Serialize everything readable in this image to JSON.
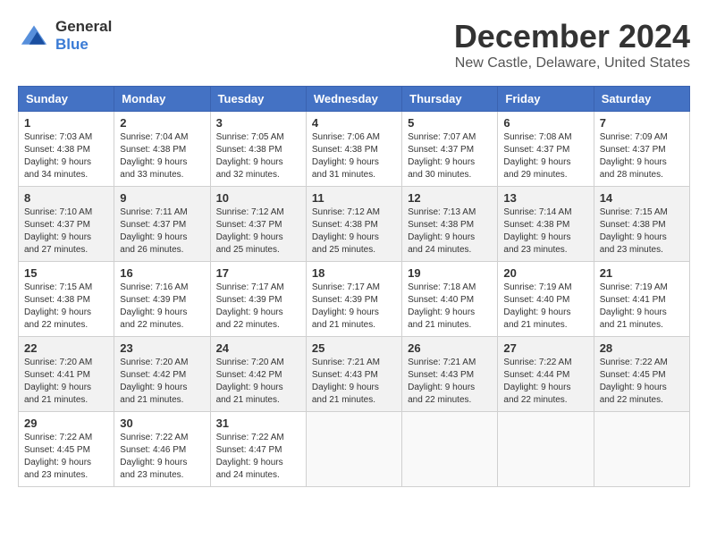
{
  "header": {
    "logo_general": "General",
    "logo_blue": "Blue",
    "title": "December 2024",
    "subtitle": "New Castle, Delaware, United States"
  },
  "columns": [
    "Sunday",
    "Monday",
    "Tuesday",
    "Wednesday",
    "Thursday",
    "Friday",
    "Saturday"
  ],
  "weeks": [
    [
      {
        "day": "1",
        "sunrise": "Sunrise: 7:03 AM",
        "sunset": "Sunset: 4:38 PM",
        "daylight": "Daylight: 9 hours and 34 minutes."
      },
      {
        "day": "2",
        "sunrise": "Sunrise: 7:04 AM",
        "sunset": "Sunset: 4:38 PM",
        "daylight": "Daylight: 9 hours and 33 minutes."
      },
      {
        "day": "3",
        "sunrise": "Sunrise: 7:05 AM",
        "sunset": "Sunset: 4:38 PM",
        "daylight": "Daylight: 9 hours and 32 minutes."
      },
      {
        "day": "4",
        "sunrise": "Sunrise: 7:06 AM",
        "sunset": "Sunset: 4:38 PM",
        "daylight": "Daylight: 9 hours and 31 minutes."
      },
      {
        "day": "5",
        "sunrise": "Sunrise: 7:07 AM",
        "sunset": "Sunset: 4:37 PM",
        "daylight": "Daylight: 9 hours and 30 minutes."
      },
      {
        "day": "6",
        "sunrise": "Sunrise: 7:08 AM",
        "sunset": "Sunset: 4:37 PM",
        "daylight": "Daylight: 9 hours and 29 minutes."
      },
      {
        "day": "7",
        "sunrise": "Sunrise: 7:09 AM",
        "sunset": "Sunset: 4:37 PM",
        "daylight": "Daylight: 9 hours and 28 minutes."
      }
    ],
    [
      {
        "day": "8",
        "sunrise": "Sunrise: 7:10 AM",
        "sunset": "Sunset: 4:37 PM",
        "daylight": "Daylight: 9 hours and 27 minutes."
      },
      {
        "day": "9",
        "sunrise": "Sunrise: 7:11 AM",
        "sunset": "Sunset: 4:37 PM",
        "daylight": "Daylight: 9 hours and 26 minutes."
      },
      {
        "day": "10",
        "sunrise": "Sunrise: 7:12 AM",
        "sunset": "Sunset: 4:37 PM",
        "daylight": "Daylight: 9 hours and 25 minutes."
      },
      {
        "day": "11",
        "sunrise": "Sunrise: 7:12 AM",
        "sunset": "Sunset: 4:38 PM",
        "daylight": "Daylight: 9 hours and 25 minutes."
      },
      {
        "day": "12",
        "sunrise": "Sunrise: 7:13 AM",
        "sunset": "Sunset: 4:38 PM",
        "daylight": "Daylight: 9 hours and 24 minutes."
      },
      {
        "day": "13",
        "sunrise": "Sunrise: 7:14 AM",
        "sunset": "Sunset: 4:38 PM",
        "daylight": "Daylight: 9 hours and 23 minutes."
      },
      {
        "day": "14",
        "sunrise": "Sunrise: 7:15 AM",
        "sunset": "Sunset: 4:38 PM",
        "daylight": "Daylight: 9 hours and 23 minutes."
      }
    ],
    [
      {
        "day": "15",
        "sunrise": "Sunrise: 7:15 AM",
        "sunset": "Sunset: 4:38 PM",
        "daylight": "Daylight: 9 hours and 22 minutes."
      },
      {
        "day": "16",
        "sunrise": "Sunrise: 7:16 AM",
        "sunset": "Sunset: 4:39 PM",
        "daylight": "Daylight: 9 hours and 22 minutes."
      },
      {
        "day": "17",
        "sunrise": "Sunrise: 7:17 AM",
        "sunset": "Sunset: 4:39 PM",
        "daylight": "Daylight: 9 hours and 22 minutes."
      },
      {
        "day": "18",
        "sunrise": "Sunrise: 7:17 AM",
        "sunset": "Sunset: 4:39 PM",
        "daylight": "Daylight: 9 hours and 21 minutes."
      },
      {
        "day": "19",
        "sunrise": "Sunrise: 7:18 AM",
        "sunset": "Sunset: 4:40 PM",
        "daylight": "Daylight: 9 hours and 21 minutes."
      },
      {
        "day": "20",
        "sunrise": "Sunrise: 7:19 AM",
        "sunset": "Sunset: 4:40 PM",
        "daylight": "Daylight: 9 hours and 21 minutes."
      },
      {
        "day": "21",
        "sunrise": "Sunrise: 7:19 AM",
        "sunset": "Sunset: 4:41 PM",
        "daylight": "Daylight: 9 hours and 21 minutes."
      }
    ],
    [
      {
        "day": "22",
        "sunrise": "Sunrise: 7:20 AM",
        "sunset": "Sunset: 4:41 PM",
        "daylight": "Daylight: 9 hours and 21 minutes."
      },
      {
        "day": "23",
        "sunrise": "Sunrise: 7:20 AM",
        "sunset": "Sunset: 4:42 PM",
        "daylight": "Daylight: 9 hours and 21 minutes."
      },
      {
        "day": "24",
        "sunrise": "Sunrise: 7:20 AM",
        "sunset": "Sunset: 4:42 PM",
        "daylight": "Daylight: 9 hours and 21 minutes."
      },
      {
        "day": "25",
        "sunrise": "Sunrise: 7:21 AM",
        "sunset": "Sunset: 4:43 PM",
        "daylight": "Daylight: 9 hours and 21 minutes."
      },
      {
        "day": "26",
        "sunrise": "Sunrise: 7:21 AM",
        "sunset": "Sunset: 4:43 PM",
        "daylight": "Daylight: 9 hours and 22 minutes."
      },
      {
        "day": "27",
        "sunrise": "Sunrise: 7:22 AM",
        "sunset": "Sunset: 4:44 PM",
        "daylight": "Daylight: 9 hours and 22 minutes."
      },
      {
        "day": "28",
        "sunrise": "Sunrise: 7:22 AM",
        "sunset": "Sunset: 4:45 PM",
        "daylight": "Daylight: 9 hours and 22 minutes."
      }
    ],
    [
      {
        "day": "29",
        "sunrise": "Sunrise: 7:22 AM",
        "sunset": "Sunset: 4:45 PM",
        "daylight": "Daylight: 9 hours and 23 minutes."
      },
      {
        "day": "30",
        "sunrise": "Sunrise: 7:22 AM",
        "sunset": "Sunset: 4:46 PM",
        "daylight": "Daylight: 9 hours and 23 minutes."
      },
      {
        "day": "31",
        "sunrise": "Sunrise: 7:22 AM",
        "sunset": "Sunset: 4:47 PM",
        "daylight": "Daylight: 9 hours and 24 minutes."
      },
      null,
      null,
      null,
      null
    ]
  ]
}
